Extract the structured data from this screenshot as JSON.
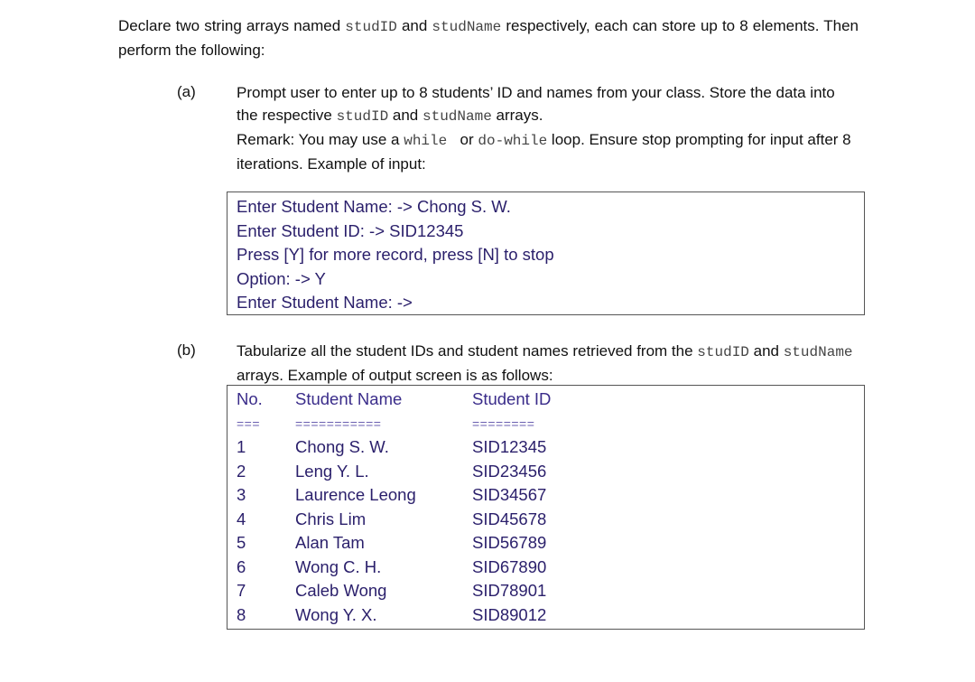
{
  "intro": {
    "t1": "Declare two string arrays named ",
    "code1": "studID",
    "t2": " and ",
    "code2": "studName",
    "t3": " respectively, each can store up to 8 elements. Then perform the following:"
  },
  "part_a": {
    "label": "(a)",
    "p1": "Prompt user to enter up to 8 students’ ID and names from your class. Store the data into the respective ",
    "code1": "studID",
    "p2": " and ",
    "code2": "studName",
    "p3": " arrays.",
    "r1": "Remark: You may use a ",
    "code3": "while ",
    "r2": " or ",
    "code4": "do-while",
    "r3": " loop. Ensure stop prompting for input after 8 iterations. Example of input:",
    "console_lines": [
      "Enter Student Name: -> Chong S. W.",
      "Enter Student ID: -> SID12345",
      "Press [Y] for more record, press [N] to stop",
      "Option: -> Y",
      "Enter Student Name: ->"
    ]
  },
  "part_b": {
    "label": "(b)",
    "p1": "Tabularize all the student IDs and student names retrieved from the ",
    "code1": "studID",
    "p2": " and ",
    "code2": "studName",
    "p3": " arrays. Example of output screen is as follows:",
    "table": {
      "headers": [
        "No.",
        "Student Name",
        "Student ID"
      ],
      "separators": [
        "===",
        "===========",
        "========"
      ],
      "rows": [
        [
          "1",
          "Chong S. W.",
          "SID12345"
        ],
        [
          "2",
          "Leng Y. L.",
          "SID23456"
        ],
        [
          "3",
          "Laurence Leong",
          "SID34567"
        ],
        [
          "4",
          "Chris Lim",
          "SID45678"
        ],
        [
          "5",
          "Alan Tam",
          "SID56789"
        ],
        [
          "6",
          "Wong C. H.",
          "SID67890"
        ],
        [
          "7",
          "Caleb Wong",
          "SID78901"
        ],
        [
          "8",
          "Wong Y. X.",
          "SID89012"
        ]
      ]
    }
  }
}
